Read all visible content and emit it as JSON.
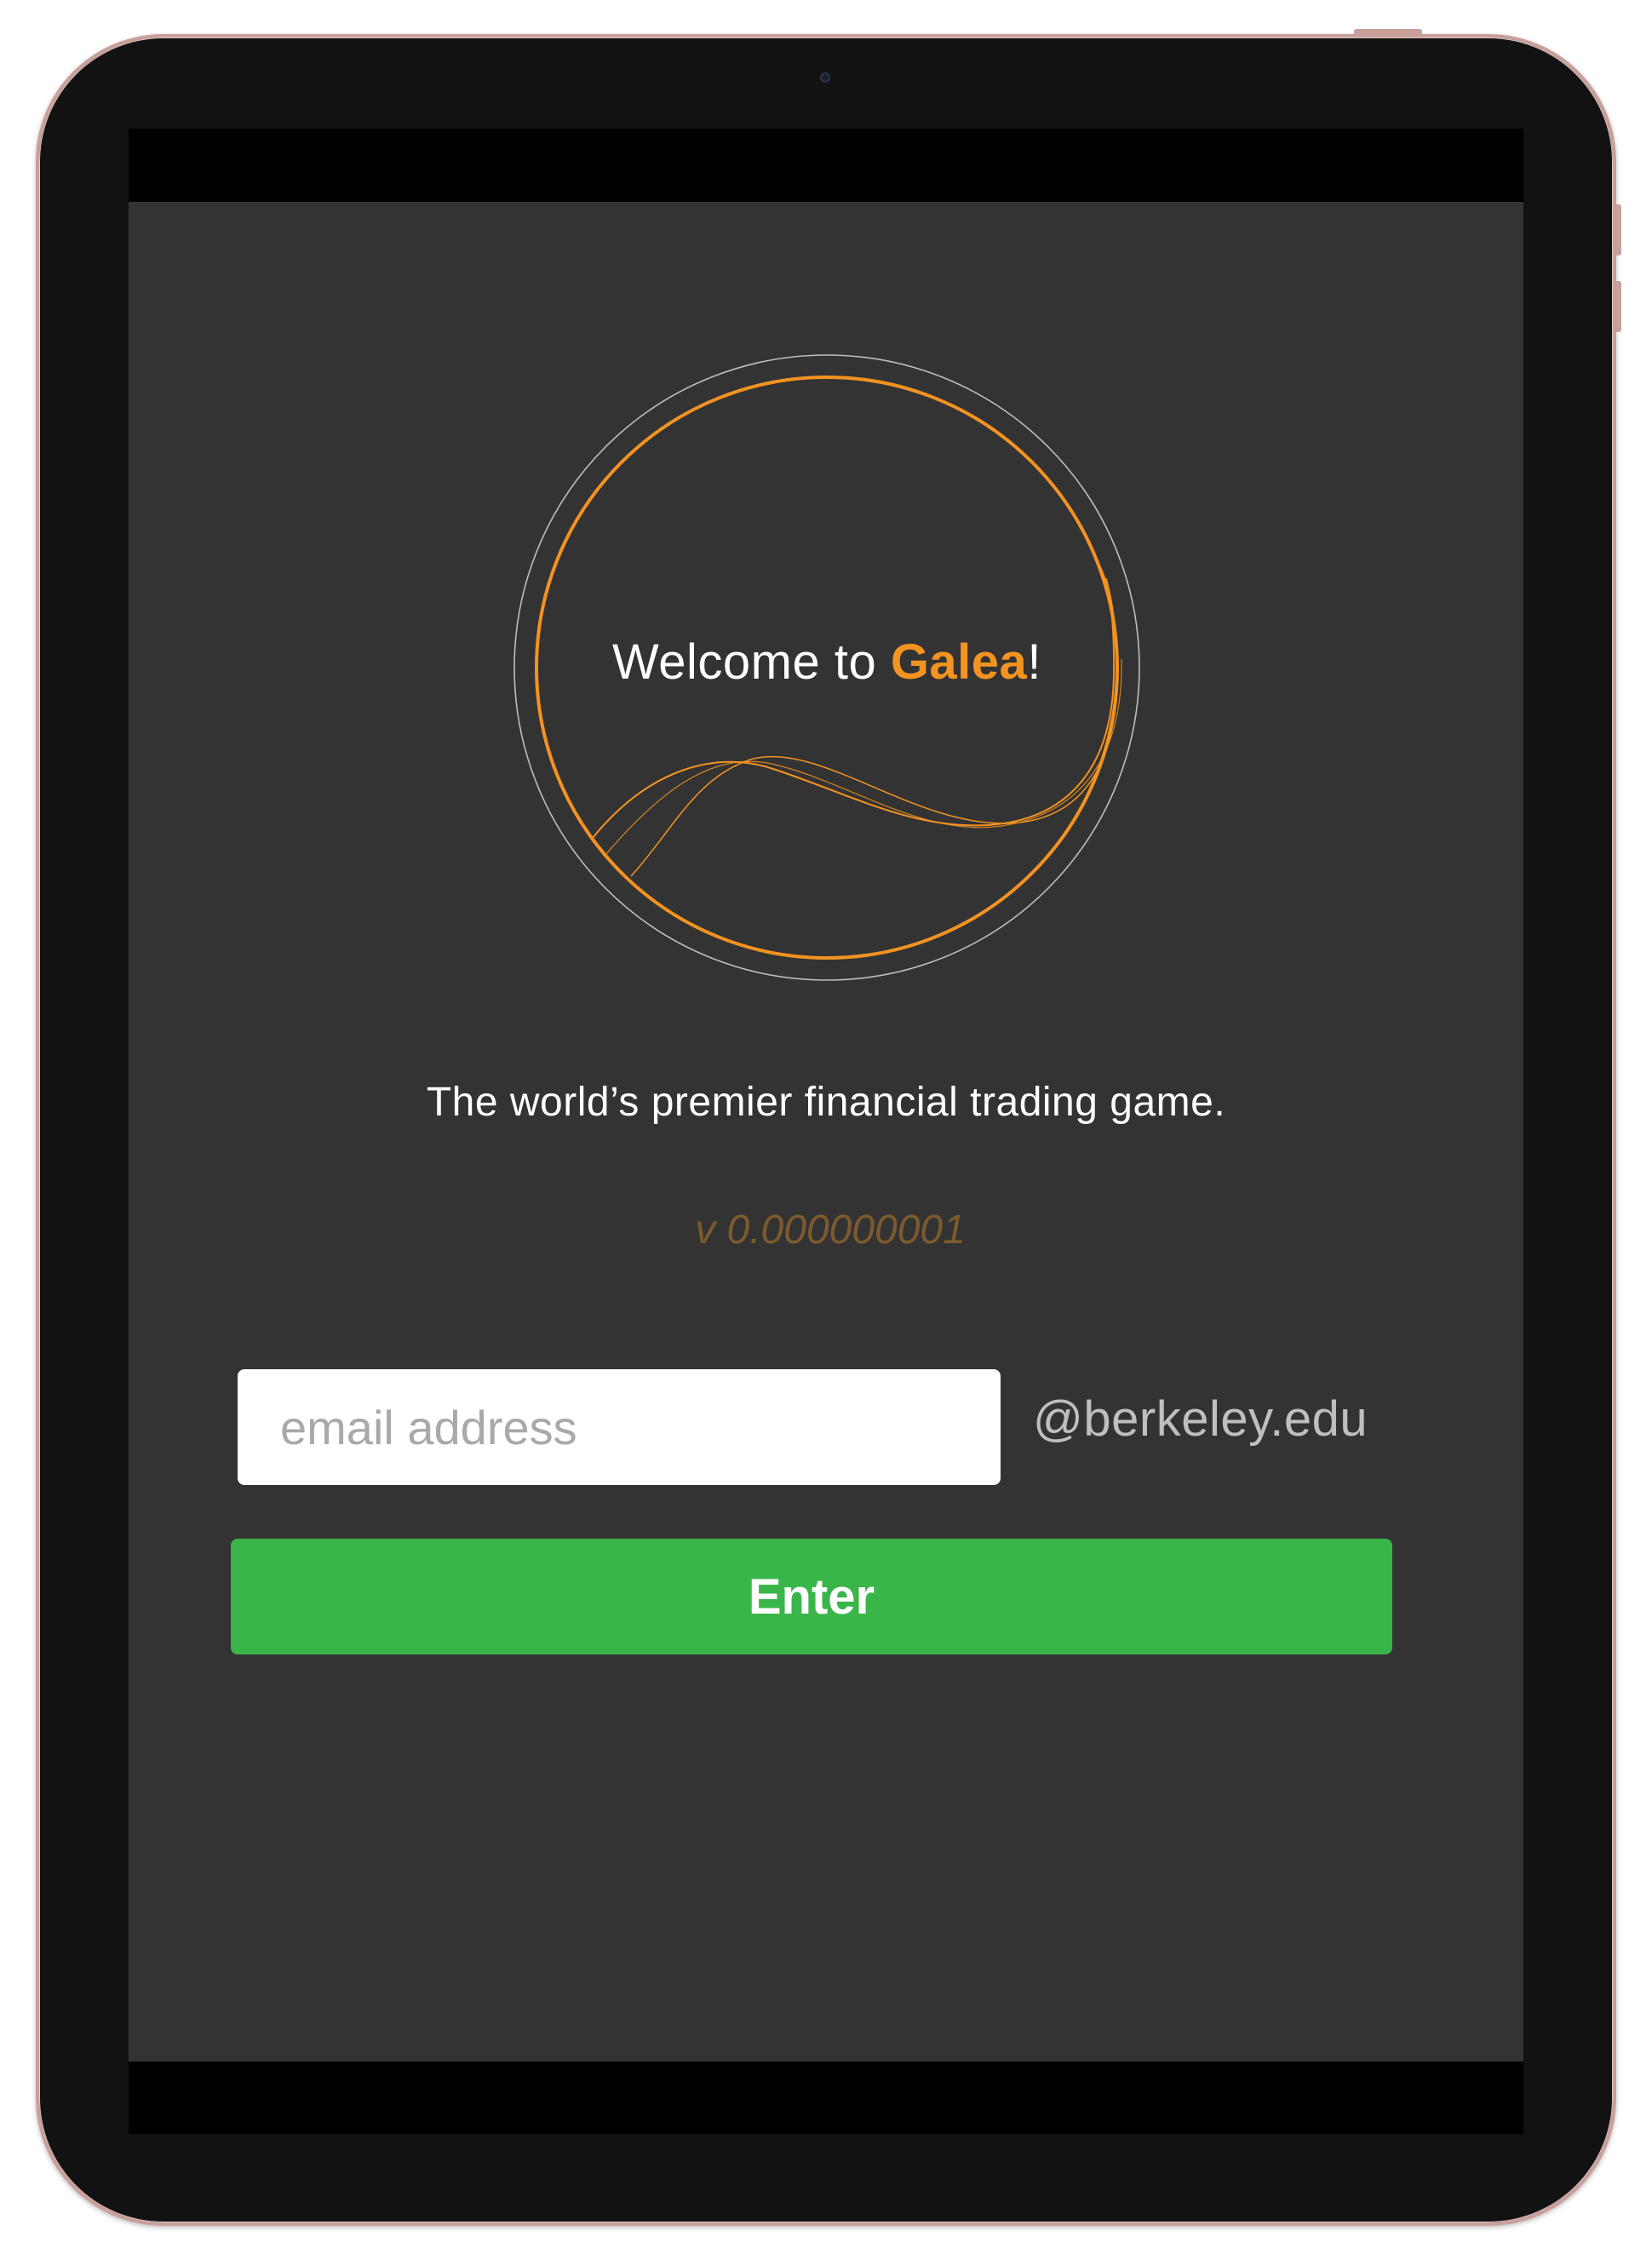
{
  "logo": {
    "welcome_prefix": "Welcome to ",
    "brand_name": "Galea",
    "welcome_suffix": "!",
    "accent_color": "#f39321",
    "ring_color": "#bdbdbd"
  },
  "tagline": "The world’s premier financial trading game.",
  "version": "v 0.000000001",
  "login": {
    "email_placeholder": "email address",
    "email_value": "",
    "domain_suffix": "@berkeley.edu",
    "enter_label": "Enter",
    "enter_color": "#3ab54a"
  },
  "colors": {
    "app_background": "#333333",
    "device_frame": "#121212",
    "device_bezel": "#c9a09a"
  }
}
